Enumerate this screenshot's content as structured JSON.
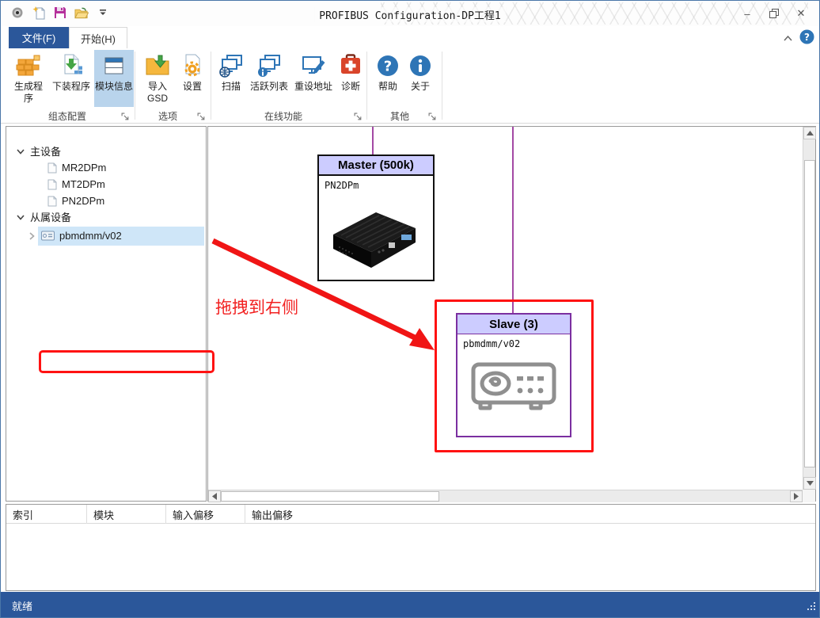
{
  "titlebar": {
    "title": "PROFIBUS Configuration-DP工程1",
    "controls": {
      "minimize": "–",
      "restore": "❐",
      "close": "✕"
    }
  },
  "tabs": {
    "file": "文件(F)",
    "home": "开始(H)"
  },
  "ribbon": {
    "groups": [
      {
        "label": "组态配置",
        "buttons": [
          {
            "label": "生成程序",
            "icon": "bricks-icon"
          },
          {
            "label": "下装程序",
            "icon": "download-program-icon"
          },
          {
            "label": "模块信息",
            "icon": "module-info-icon",
            "selected": true
          }
        ]
      },
      {
        "label": "选项",
        "buttons": [
          {
            "label": "导入GSD",
            "icon": "import-gsd-icon"
          },
          {
            "label": "设置",
            "icon": "settings-gear-icon"
          }
        ]
      },
      {
        "label": "在线功能",
        "buttons": [
          {
            "label": "扫描",
            "icon": "scan-icon"
          },
          {
            "label": "活跃列表",
            "icon": "active-list-icon"
          },
          {
            "label": "重设地址",
            "icon": "reset-address-icon"
          },
          {
            "label": "诊断",
            "icon": "diagnose-icon"
          }
        ]
      },
      {
        "label": "其他",
        "buttons": [
          {
            "label": "帮助",
            "icon": "help-icon"
          },
          {
            "label": "关于",
            "icon": "about-icon"
          }
        ]
      }
    ]
  },
  "tree": {
    "groups": [
      {
        "label": "主设备",
        "expanded": true,
        "children": [
          {
            "label": "MR2DPm"
          },
          {
            "label": "MT2DPm"
          },
          {
            "label": "PN2DPm"
          }
        ]
      },
      {
        "label": "从属设备",
        "expanded": true,
        "children": [
          {
            "label": "pbmdmm/v02",
            "selected": true
          }
        ]
      }
    ]
  },
  "canvas": {
    "master": {
      "title": "Master (500k)",
      "device_name": "PN2DPm"
    },
    "slave": {
      "title": "Slave (3)",
      "device_name": "pbmdmm/v02"
    },
    "annotation_text": "拖拽到右侧"
  },
  "module_table": {
    "columns": [
      "索引",
      "模块",
      "输入偏移",
      "输出偏移"
    ]
  },
  "statusbar": {
    "ready": "就绪"
  },
  "colors": {
    "accent_blue": "#2b579a",
    "bus_purple": "#a349a4",
    "annotation_red": "#ff1212",
    "selection_blue": "#cfe6f8",
    "header_lavender": "#ccccff",
    "slave_border_purple": "#7b2fa0"
  }
}
